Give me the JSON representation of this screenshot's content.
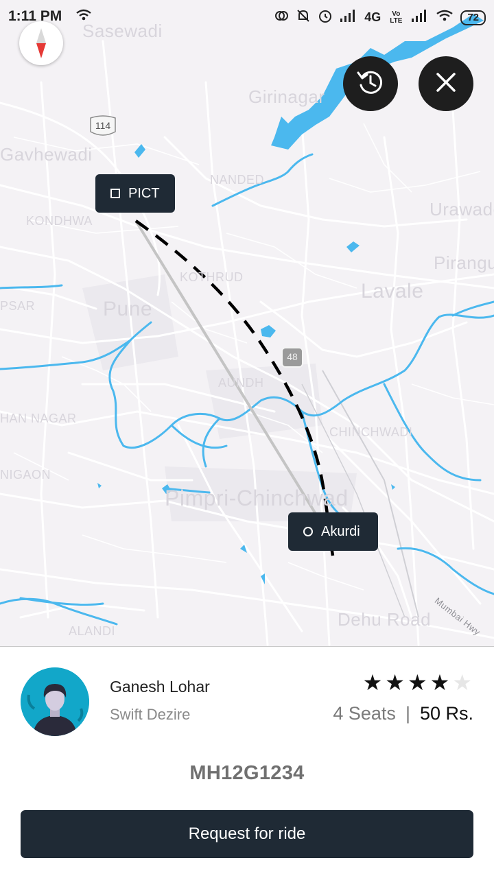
{
  "status_bar": {
    "time": "1:11 PM",
    "network": "4G",
    "volte": "Vo LTE",
    "battery": "72"
  },
  "map": {
    "labels": {
      "sasewadi": "Sasewadi",
      "ganewadi": "Gavhewadi",
      "girinagar": "Girinagar",
      "nanded": "NANDED",
      "urawade": "Urawade",
      "kondhwa": "KONDHWA",
      "pirangut": "Pirangut",
      "kothrud": "KOTHRUD",
      "lavale": "Lavale",
      "pune": "Pune",
      "hadapsar": "PSAR",
      "aundh": "AUNDH",
      "anagar": "HAN NAGAR",
      "pimpri": "Pimpri-Chinchwad",
      "tingle": "NIGAON",
      "kalewadi": "CHINCHWADI",
      "dehu": "Dehu Road",
      "mumbai_hwy": "Mumbai Hwy",
      "wadgaon": "ALANDI"
    },
    "shields": {
      "nh114": "114",
      "nh48": "48"
    },
    "markers": {
      "origin": "PICT",
      "destination": "Akurdi"
    },
    "colors": {
      "water": "#4bb8ee",
      "roads": "#ffffff",
      "land": "#f4f2f5",
      "route_dash": "#000000",
      "route_direct": "#c4c4c4"
    }
  },
  "controls": {
    "compass_icon": "compass-icon",
    "history_icon": "history-icon",
    "close_icon": "close-icon"
  },
  "driver": {
    "name": "Ganesh Lohar",
    "car": "Swift Dezire",
    "rating": 4,
    "rating_max": 5,
    "seats": "4 Seats",
    "separator": "|",
    "price": "50 Rs.",
    "plate": "MH12G1234"
  },
  "action": {
    "request_label": "Request for ride"
  },
  "theme": {
    "accent": "#1f2a35",
    "avatar_bg": "#12a7c9"
  }
}
